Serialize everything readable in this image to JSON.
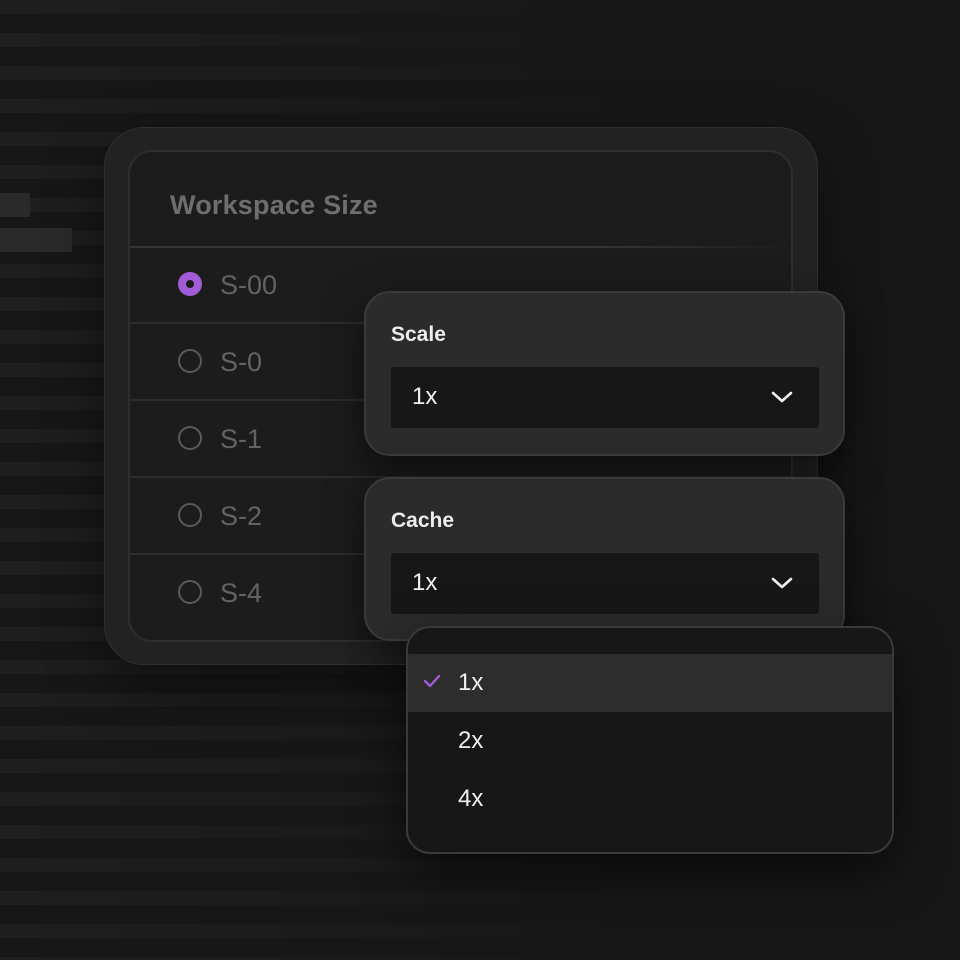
{
  "workspace": {
    "title": "Workspace Size",
    "options": [
      {
        "label": "S-00",
        "checked": true
      },
      {
        "label": "S-0",
        "checked": false
      },
      {
        "label": "S-1",
        "checked": false
      },
      {
        "label": "S-2",
        "checked": false
      },
      {
        "label": "S-4",
        "checked": false
      }
    ]
  },
  "scale": {
    "label": "Scale",
    "value": "1x",
    "icon": "chevron-down-icon"
  },
  "cache": {
    "label": "Cache",
    "value": "1x",
    "icon": "chevron-down-icon",
    "menu": {
      "items": [
        {
          "label": "1x",
          "selected": true
        },
        {
          "label": "2x",
          "selected": false
        },
        {
          "label": "4x",
          "selected": false
        }
      ],
      "check_icon": "check-icon"
    }
  },
  "colors": {
    "accent": "#a25cd6",
    "background": "#171717"
  }
}
